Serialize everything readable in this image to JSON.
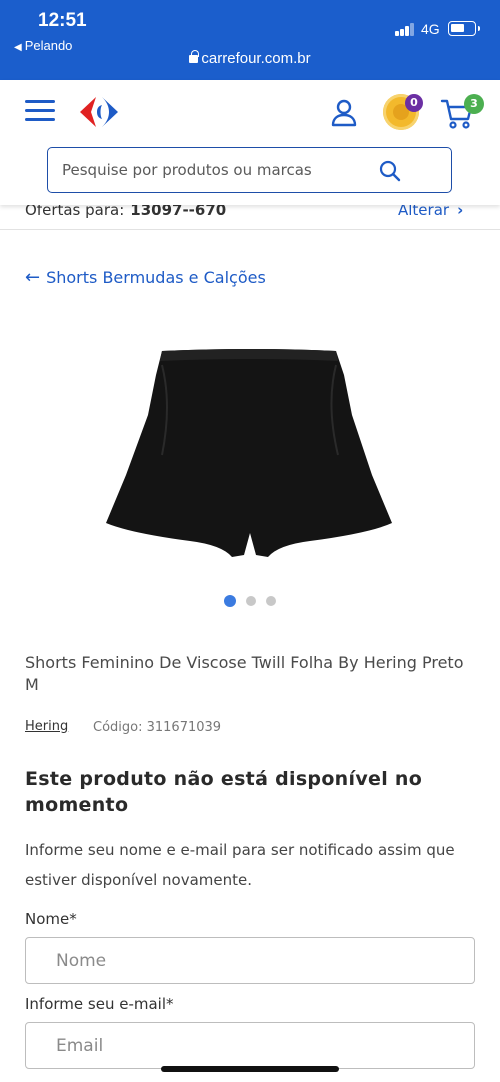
{
  "status_bar": {
    "time": "12:51",
    "back_app": "Pelando",
    "network": "4G",
    "url": "carrefour.com.br",
    "color": "#1b5ecc"
  },
  "header": {
    "coins_count": "0",
    "cart_count": "3",
    "accent_color": "#1e5bc6"
  },
  "search": {
    "placeholder": "Pesquise por produtos ou marcas"
  },
  "offers": {
    "label": "Ofertas para:",
    "zip": "13097--670",
    "change_label": "Alterar"
  },
  "breadcrumb": {
    "label": "Shorts Bermudas e Calções"
  },
  "product": {
    "title": "Shorts Feminino De Viscose Twill Folha By Hering Preto M",
    "brand": "Hering",
    "code": "Código: 311671039",
    "carousel_active_index": 0,
    "carousel_total": 3,
    "unavailable_heading": "Este produto não está disponível no momento",
    "notify_text": "Informe seu nome e e-mail para ser notificado assim que estiver disponível novamente."
  },
  "form": {
    "name_label": "Nome*",
    "name_placeholder": "Nome",
    "email_label": "Informe seu e-mail*",
    "email_placeholder": "Email"
  },
  "icons": [
    "menu-icon",
    "carrefour-logo",
    "user-icon",
    "coin-icon",
    "cart-icon",
    "search-icon",
    "arrow-left-icon",
    "chevron-right-icon",
    "lock-icon"
  ]
}
